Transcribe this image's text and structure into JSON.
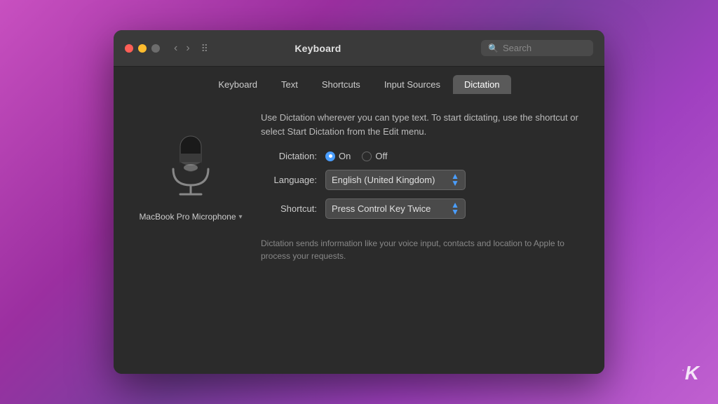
{
  "background": {
    "gradient_start": "#c850c0",
    "gradient_end": "#7b3fa0"
  },
  "window": {
    "title": "Keyboard",
    "search_placeholder": "Search"
  },
  "tabs": [
    {
      "id": "keyboard",
      "label": "Keyboard",
      "active": false
    },
    {
      "id": "text",
      "label": "Text",
      "active": false
    },
    {
      "id": "shortcuts",
      "label": "Shortcuts",
      "active": false
    },
    {
      "id": "input-sources",
      "label": "Input Sources",
      "active": false
    },
    {
      "id": "dictation",
      "label": "Dictation",
      "active": true
    }
  ],
  "content": {
    "description": "Use Dictation wherever you can type text. To start dictating, use the shortcut or select Start Dictation from the Edit menu.",
    "microphone_label": "MacBook Pro Microphone",
    "dictation_label": "Dictation:",
    "dictation_on_label": "On",
    "dictation_off_label": "Off",
    "dictation_on_selected": true,
    "language_label": "Language:",
    "language_value": "English (United Kingdom)",
    "shortcut_label": "Shortcut:",
    "shortcut_value": "Press Control Key Twice",
    "footer_text": "Dictation sends information like your voice input, contacts and location to Apple to process your requests."
  },
  "logo": "K"
}
